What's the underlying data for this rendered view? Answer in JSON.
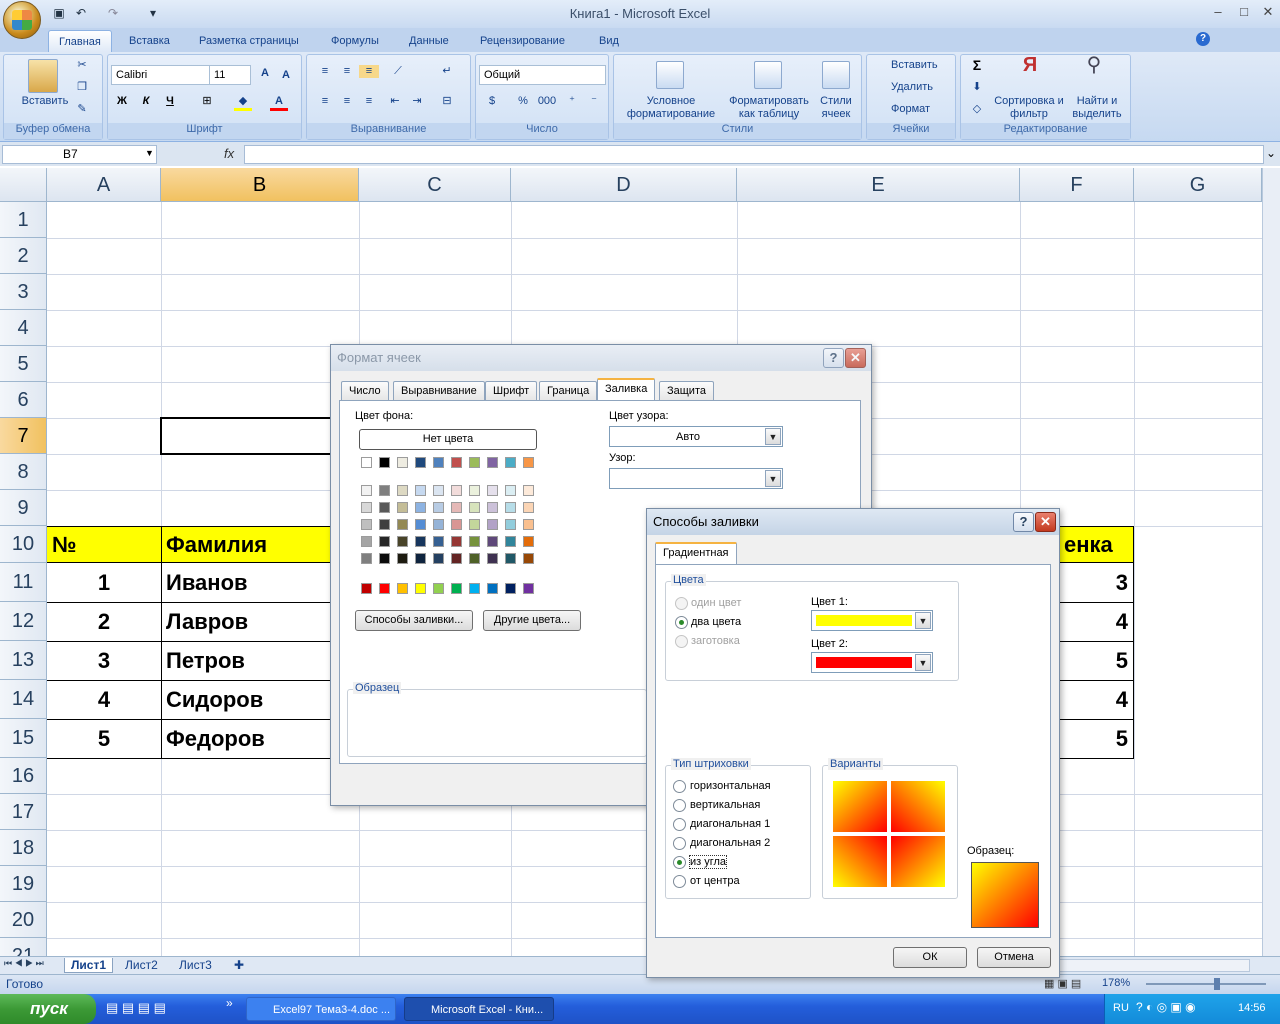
{
  "window": {
    "title": "Книга1 - Microsoft Excel",
    "min": "–",
    "max": "□",
    "close": "✕"
  },
  "ribbon": {
    "tabs": [
      "Главная",
      "Вставка",
      "Разметка страницы",
      "Формулы",
      "Данные",
      "Рецензирование",
      "Вид"
    ],
    "clipboard": {
      "paste": "Вставить",
      "label": "Буфер обмена"
    },
    "font": {
      "name": "Calibri",
      "size": "11",
      "label": "Шрифт",
      "bold": "Ж",
      "italic": "К",
      "underline": "Ч"
    },
    "align": {
      "label": "Выравнивание"
    },
    "number": {
      "format": "Общий",
      "label": "Число",
      "pct": "%",
      "thousands": "000"
    },
    "styles": {
      "cond": "Условное форматирование",
      "table": "Форматировать как таблицу",
      "cell": "Стили ячеек",
      "label": "Стили"
    },
    "cells": {
      "insert": "Вставить",
      "delete": "Удалить",
      "format": "Формат",
      "label": "Ячейки"
    },
    "edit": {
      "sum": "Σ",
      "sort": "Сортировка и фильтр",
      "find": "Найти и выделить",
      "label": "Редактирование"
    }
  },
  "formula": {
    "namebox": "B7",
    "fx": "fx"
  },
  "grid": {
    "columns": [
      "A",
      "B",
      "C",
      "D",
      "E",
      "F",
      "G"
    ],
    "rows": [
      "1",
      "2",
      "3",
      "4",
      "5",
      "6",
      "7",
      "8",
      "9",
      "10",
      "11",
      "12",
      "13",
      "14",
      "15",
      "16",
      "17",
      "18",
      "19",
      "20",
      "21"
    ],
    "header_row": {
      "num": "№",
      "name": "Фамилия",
      "grade": "енка"
    },
    "data": [
      {
        "n": "1",
        "name": "Иванов",
        "g": "3"
      },
      {
        "n": "2",
        "name": "Лавров",
        "g": "4"
      },
      {
        "n": "3",
        "name": "Петров",
        "g": "5"
      },
      {
        "n": "4",
        "name": "Сидоров",
        "g": "4"
      },
      {
        "n": "5",
        "name": "Федоров",
        "g": "5"
      }
    ]
  },
  "sheets": [
    "Лист1",
    "Лист2",
    "Лист3"
  ],
  "status": {
    "ready": "Готово",
    "zoom": "178%"
  },
  "format_dialog": {
    "title": "Формат ячеек",
    "tabs": [
      "Число",
      "Выравнивание",
      "Шрифт",
      "Граница",
      "Заливка",
      "Защита"
    ],
    "bg_label": "Цвет фона:",
    "no_color": "Нет цвета",
    "pattern_color_label": "Цвет узора:",
    "pattern_color": "Авто",
    "pattern_label": "Узор:",
    "fill_effects_btn": "Способы заливки...",
    "more_colors_btn": "Другие цвета...",
    "sample": "Образец"
  },
  "fill_dialog": {
    "title": "Способы заливки",
    "tab": "Градиентная",
    "colors_legend": "Цвета",
    "opt_one": "один цвет",
    "opt_two": "два цвета",
    "opt_preset": "заготовка",
    "color1_label": "Цвет 1:",
    "color2_label": "Цвет 2:",
    "color1": "#ffff00",
    "color2": "#ff0000",
    "shading_legend": "Тип штриховки",
    "shading": [
      "горизонтальная",
      "вертикальная",
      "диагональная 1",
      "диагональная 2",
      "из угла",
      "от центра"
    ],
    "variants_legend": "Варианты",
    "sample_label": "Образец:",
    "ok": "ОК",
    "cancel": "Отмена"
  },
  "taskbar": {
    "start": "пуск",
    "items": [
      "Excel97 Тема3-4.doc ...",
      "Microsoft Excel - Кни..."
    ],
    "lang": "RU",
    "time": "14:56"
  }
}
